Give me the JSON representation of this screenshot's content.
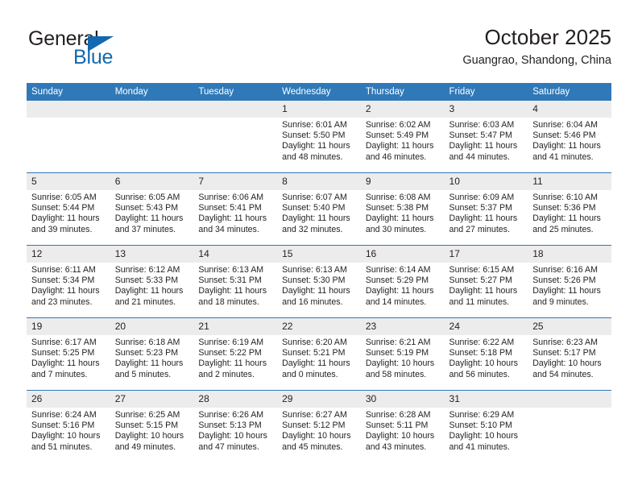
{
  "logo": {
    "word_one": "General",
    "word_two": "Blue",
    "triangle": "triangle-icon",
    "accent_color": "#1269b0"
  },
  "header": {
    "title": "October 2025",
    "subtitle": "Guangrao, Shandong, China"
  },
  "theme": {
    "header_blue": "#3079b8",
    "daynum_gray": "#ececec",
    "text": "#231f20"
  },
  "calendar": {
    "weekday_headers": [
      "Sunday",
      "Monday",
      "Tuesday",
      "Wednesday",
      "Thursday",
      "Friday",
      "Saturday"
    ],
    "weeks": [
      [
        {
          "day": "",
          "lines": []
        },
        {
          "day": "",
          "lines": []
        },
        {
          "day": "",
          "lines": []
        },
        {
          "day": "1",
          "lines": [
            "Sunrise: 6:01 AM",
            "Sunset: 5:50 PM",
            "Daylight: 11 hours",
            "and 48 minutes."
          ]
        },
        {
          "day": "2",
          "lines": [
            "Sunrise: 6:02 AM",
            "Sunset: 5:49 PM",
            "Daylight: 11 hours",
            "and 46 minutes."
          ]
        },
        {
          "day": "3",
          "lines": [
            "Sunrise: 6:03 AM",
            "Sunset: 5:47 PM",
            "Daylight: 11 hours",
            "and 44 minutes."
          ]
        },
        {
          "day": "4",
          "lines": [
            "Sunrise: 6:04 AM",
            "Sunset: 5:46 PM",
            "Daylight: 11 hours",
            "and 41 minutes."
          ]
        }
      ],
      [
        {
          "day": "5",
          "lines": [
            "Sunrise: 6:05 AM",
            "Sunset: 5:44 PM",
            "Daylight: 11 hours",
            "and 39 minutes."
          ]
        },
        {
          "day": "6",
          "lines": [
            "Sunrise: 6:05 AM",
            "Sunset: 5:43 PM",
            "Daylight: 11 hours",
            "and 37 minutes."
          ]
        },
        {
          "day": "7",
          "lines": [
            "Sunrise: 6:06 AM",
            "Sunset: 5:41 PM",
            "Daylight: 11 hours",
            "and 34 minutes."
          ]
        },
        {
          "day": "8",
          "lines": [
            "Sunrise: 6:07 AM",
            "Sunset: 5:40 PM",
            "Daylight: 11 hours",
            "and 32 minutes."
          ]
        },
        {
          "day": "9",
          "lines": [
            "Sunrise: 6:08 AM",
            "Sunset: 5:38 PM",
            "Daylight: 11 hours",
            "and 30 minutes."
          ]
        },
        {
          "day": "10",
          "lines": [
            "Sunrise: 6:09 AM",
            "Sunset: 5:37 PM",
            "Daylight: 11 hours",
            "and 27 minutes."
          ]
        },
        {
          "day": "11",
          "lines": [
            "Sunrise: 6:10 AM",
            "Sunset: 5:36 PM",
            "Daylight: 11 hours",
            "and 25 minutes."
          ]
        }
      ],
      [
        {
          "day": "12",
          "lines": [
            "Sunrise: 6:11 AM",
            "Sunset: 5:34 PM",
            "Daylight: 11 hours",
            "and 23 minutes."
          ]
        },
        {
          "day": "13",
          "lines": [
            "Sunrise: 6:12 AM",
            "Sunset: 5:33 PM",
            "Daylight: 11 hours",
            "and 21 minutes."
          ]
        },
        {
          "day": "14",
          "lines": [
            "Sunrise: 6:13 AM",
            "Sunset: 5:31 PM",
            "Daylight: 11 hours",
            "and 18 minutes."
          ]
        },
        {
          "day": "15",
          "lines": [
            "Sunrise: 6:13 AM",
            "Sunset: 5:30 PM",
            "Daylight: 11 hours",
            "and 16 minutes."
          ]
        },
        {
          "day": "16",
          "lines": [
            "Sunrise: 6:14 AM",
            "Sunset: 5:29 PM",
            "Daylight: 11 hours",
            "and 14 minutes."
          ]
        },
        {
          "day": "17",
          "lines": [
            "Sunrise: 6:15 AM",
            "Sunset: 5:27 PM",
            "Daylight: 11 hours",
            "and 11 minutes."
          ]
        },
        {
          "day": "18",
          "lines": [
            "Sunrise: 6:16 AM",
            "Sunset: 5:26 PM",
            "Daylight: 11 hours",
            "and 9 minutes."
          ]
        }
      ],
      [
        {
          "day": "19",
          "lines": [
            "Sunrise: 6:17 AM",
            "Sunset: 5:25 PM",
            "Daylight: 11 hours",
            "and 7 minutes."
          ]
        },
        {
          "day": "20",
          "lines": [
            "Sunrise: 6:18 AM",
            "Sunset: 5:23 PM",
            "Daylight: 11 hours",
            "and 5 minutes."
          ]
        },
        {
          "day": "21",
          "lines": [
            "Sunrise: 6:19 AM",
            "Sunset: 5:22 PM",
            "Daylight: 11 hours",
            "and 2 minutes."
          ]
        },
        {
          "day": "22",
          "lines": [
            "Sunrise: 6:20 AM",
            "Sunset: 5:21 PM",
            "Daylight: 11 hours",
            "and 0 minutes."
          ]
        },
        {
          "day": "23",
          "lines": [
            "Sunrise: 6:21 AM",
            "Sunset: 5:19 PM",
            "Daylight: 10 hours",
            "and 58 minutes."
          ]
        },
        {
          "day": "24",
          "lines": [
            "Sunrise: 6:22 AM",
            "Sunset: 5:18 PM",
            "Daylight: 10 hours",
            "and 56 minutes."
          ]
        },
        {
          "day": "25",
          "lines": [
            "Sunrise: 6:23 AM",
            "Sunset: 5:17 PM",
            "Daylight: 10 hours",
            "and 54 minutes."
          ]
        }
      ],
      [
        {
          "day": "26",
          "lines": [
            "Sunrise: 6:24 AM",
            "Sunset: 5:16 PM",
            "Daylight: 10 hours",
            "and 51 minutes."
          ]
        },
        {
          "day": "27",
          "lines": [
            "Sunrise: 6:25 AM",
            "Sunset: 5:15 PM",
            "Daylight: 10 hours",
            "and 49 minutes."
          ]
        },
        {
          "day": "28",
          "lines": [
            "Sunrise: 6:26 AM",
            "Sunset: 5:13 PM",
            "Daylight: 10 hours",
            "and 47 minutes."
          ]
        },
        {
          "day": "29",
          "lines": [
            "Sunrise: 6:27 AM",
            "Sunset: 5:12 PM",
            "Daylight: 10 hours",
            "and 45 minutes."
          ]
        },
        {
          "day": "30",
          "lines": [
            "Sunrise: 6:28 AM",
            "Sunset: 5:11 PM",
            "Daylight: 10 hours",
            "and 43 minutes."
          ]
        },
        {
          "day": "31",
          "lines": [
            "Sunrise: 6:29 AM",
            "Sunset: 5:10 PM",
            "Daylight: 10 hours",
            "and 41 minutes."
          ]
        },
        {
          "day": "",
          "lines": []
        }
      ]
    ]
  }
}
